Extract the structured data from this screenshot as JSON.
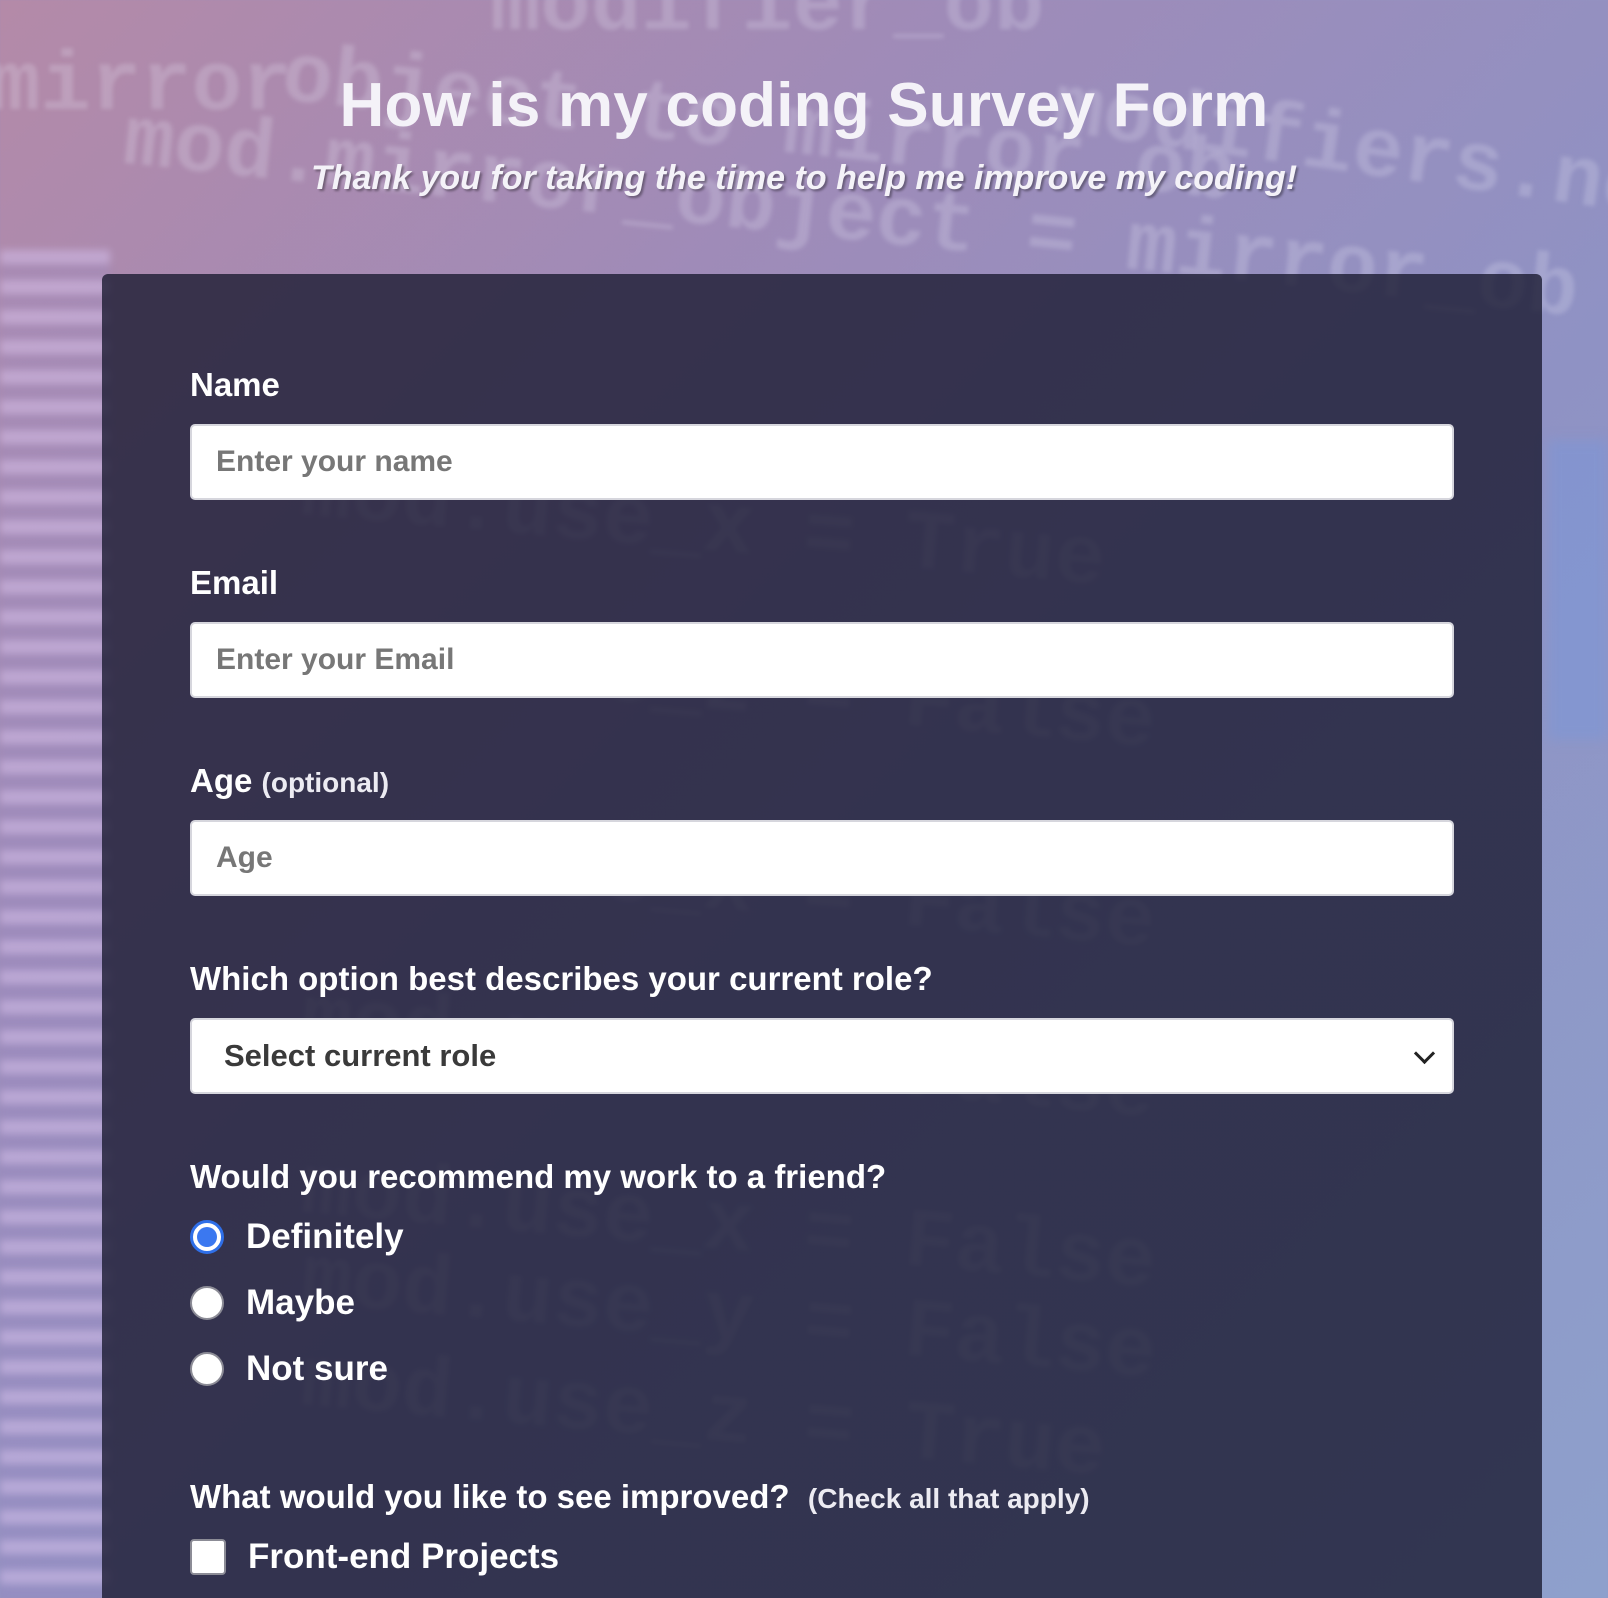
{
  "header": {
    "title": "How is my coding Survey Form",
    "description": "Thank you for taking the time to help me improve my coding!"
  },
  "form": {
    "name": {
      "label": "Name",
      "placeholder": "Enter your name",
      "value": ""
    },
    "email": {
      "label": "Email",
      "placeholder": "Enter your Email",
      "value": ""
    },
    "age": {
      "label": "Age",
      "clue": "(optional)",
      "placeholder": "Age",
      "value": ""
    },
    "role": {
      "label": "Which option best describes your current role?",
      "selected": "Select current role"
    },
    "recommend": {
      "label": "Would you recommend my work to a friend?",
      "options": [
        {
          "label": "Definitely",
          "checked": true
        },
        {
          "label": "Maybe",
          "checked": false
        },
        {
          "label": "Not sure",
          "checked": false
        }
      ]
    },
    "improve": {
      "label": "What would you like to see improved?",
      "clue": "(Check all that apply)",
      "options": [
        {
          "label": "Front-end Projects",
          "checked": false
        }
      ]
    }
  },
  "colors": {
    "card_background": "#1b1b32",
    "radio_accent": "#3b78f0",
    "text": "#ffffff"
  }
}
